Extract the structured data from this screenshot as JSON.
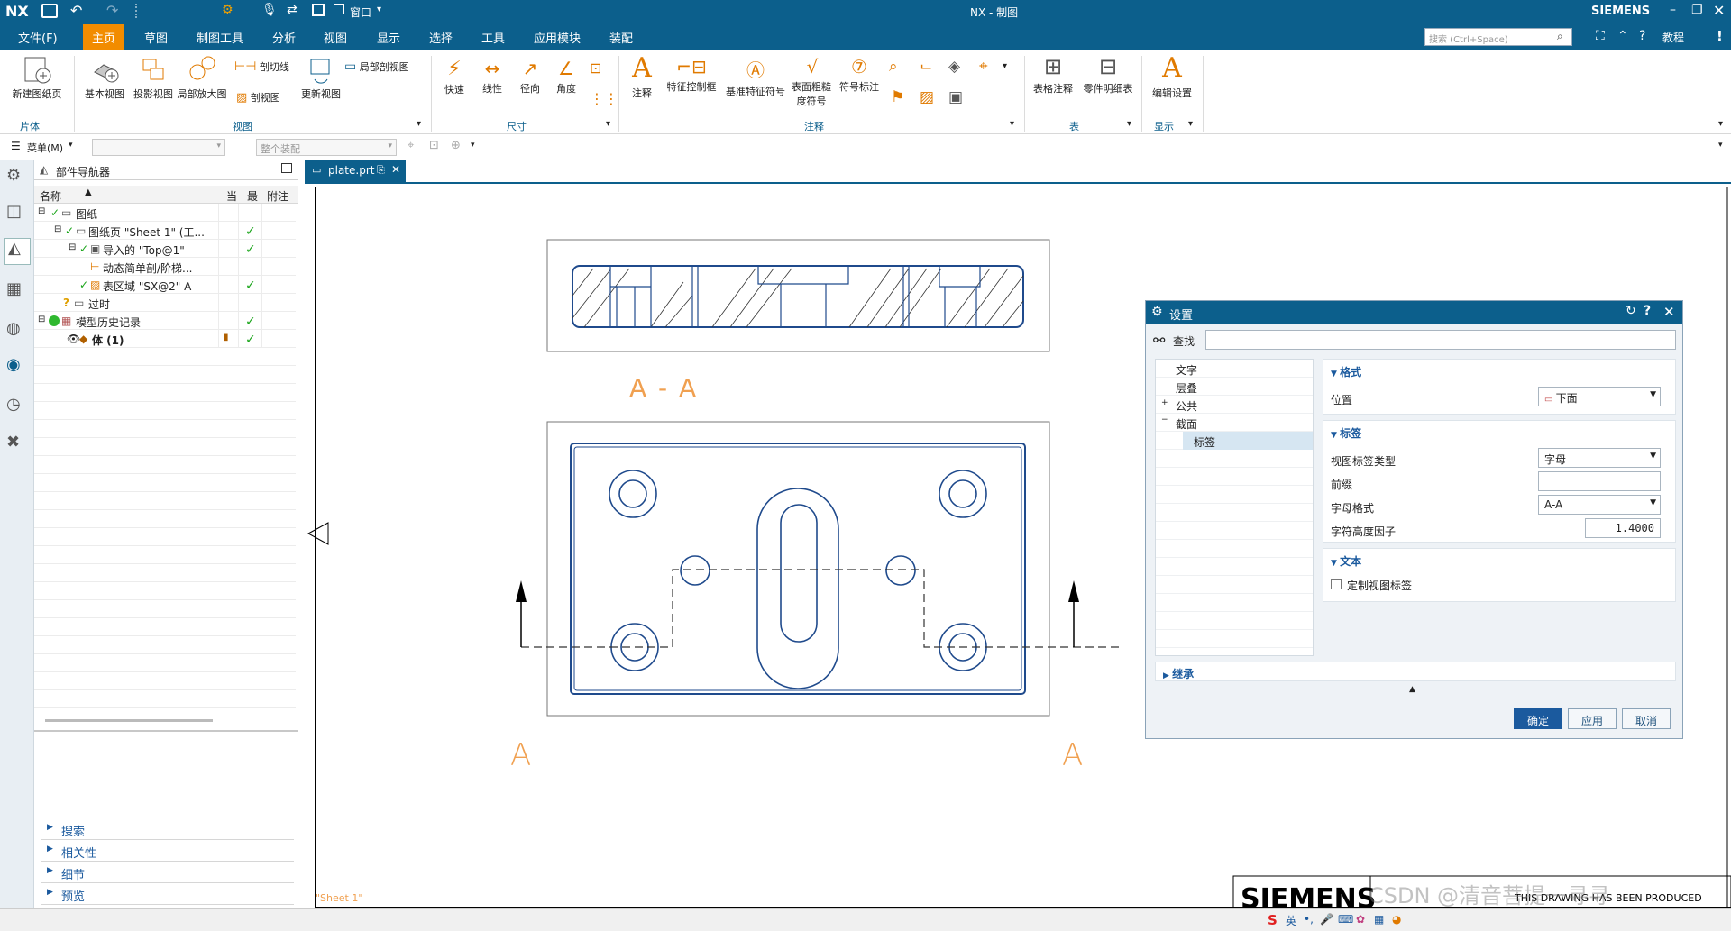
{
  "app": {
    "logo": "NX",
    "title": "NX - 制图",
    "brand": "SIEMENS",
    "window_menu": "窗口",
    "search_placeholder": "搜索 (Ctrl+Space)",
    "help": "教程"
  },
  "menu": {
    "file": "文件(F)",
    "tabs": [
      "主页",
      "草图",
      "制图工具",
      "分析",
      "视图",
      "显示",
      "选择",
      "工具",
      "应用模块",
      "装配"
    ]
  },
  "ribbon": {
    "sheet": {
      "new_sheet": "新建图纸页",
      "group": "片体"
    },
    "view": {
      "base": "基本视图",
      "projected": "投影视图",
      "detail": "局部放大图",
      "section_line": "剖切线",
      "section": "剖视图",
      "update": "更新视图",
      "break_out": "局部剖视图",
      "group": "视图"
    },
    "dim": {
      "rapid": "快速",
      "linear": "线性",
      "radial": "径向",
      "angular": "角度",
      "group": "尺寸"
    },
    "annot": {
      "note": "注释",
      "fcf": "特征控制框",
      "datum": "基准特征符号",
      "surface": "表面粗糙度符号",
      "symbol": "符号标注",
      "group": "注释"
    },
    "table": {
      "tabular": "表格注释",
      "parts_list": "零件明细表",
      "group": "表"
    },
    "display": {
      "edit_settings": "编辑设置",
      "group": "显示"
    }
  },
  "toolbar2": {
    "menu": "菜单(M)",
    "assembly": "整个装配"
  },
  "navigator": {
    "title": "部件导航器",
    "columns": [
      "名称",
      "当",
      "最",
      "附注"
    ],
    "rows": [
      {
        "label": "图纸",
        "check": ""
      },
      {
        "label": "图纸页 \"Sheet 1\" (工...",
        "check": "✓"
      },
      {
        "label": "导入的 \"Top@1\"",
        "check": "✓"
      },
      {
        "label": "动态简单剖/阶梯...",
        "check": ""
      },
      {
        "label": "表区域 \"SX@2\" A",
        "check": "✓"
      },
      {
        "label": "过时",
        "check": ""
      },
      {
        "label": "模型历史记录",
        "check": "✓"
      },
      {
        "label": "体 (1)",
        "check": "✓"
      }
    ],
    "sections": [
      "搜索",
      "相关性",
      "细节",
      "预览"
    ]
  },
  "drawing": {
    "tab": "plate.prt",
    "section_title": "A - A",
    "arrow_label": "A",
    "sheet_name": "\"Sheet 1\"",
    "title_block": "THIS DRAWING HAS BEEN PRODUCED",
    "title_logo": "SIEMENS",
    "watermark": "CSDN @清音菩提一寻寻"
  },
  "dialog": {
    "title": "设置",
    "find_label": "查找",
    "tree": [
      "文字",
      "层叠",
      "公共",
      "截面",
      "标签"
    ],
    "format": {
      "header": "格式",
      "position_label": "位置",
      "position_value": "下面"
    },
    "label_sec": {
      "header": "标签",
      "type_label": "视图标签类型",
      "type_value": "字母",
      "prefix_label": "前缀",
      "prefix_value": "",
      "letter_fmt_label": "字母格式",
      "letter_fmt_value": "A-A",
      "height_label": "字符高度因子",
      "height_value": "1.4000"
    },
    "text_sec": {
      "header": "文本",
      "custom_label": "定制视图标签"
    },
    "inherit": "继承",
    "buttons": {
      "ok": "确定",
      "apply": "应用",
      "cancel": "取消"
    }
  },
  "ime": {
    "lang": "英"
  }
}
